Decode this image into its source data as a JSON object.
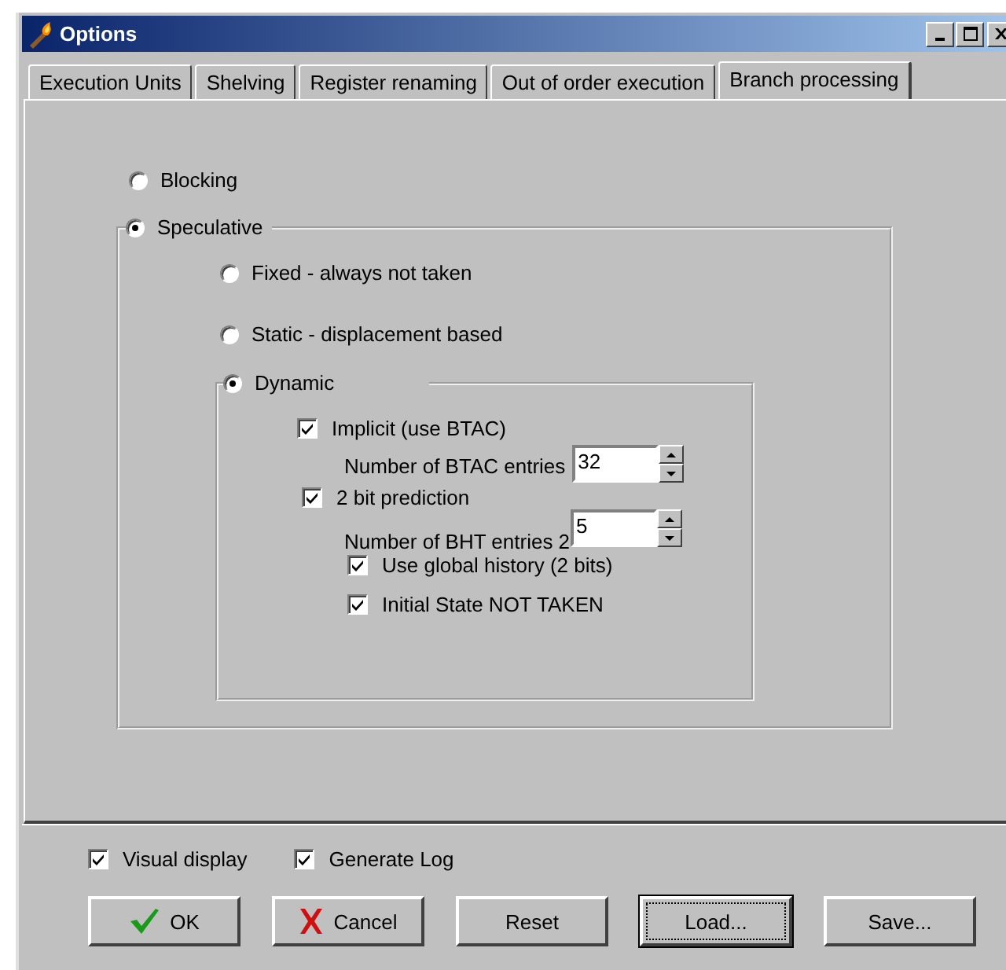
{
  "window": {
    "title": "Options"
  },
  "tabs": [
    {
      "label": "Execution Units",
      "selected": false
    },
    {
      "label": "Shelving",
      "selected": false
    },
    {
      "label": "Register renaming",
      "selected": false
    },
    {
      "label": "Out of order execution",
      "selected": false
    },
    {
      "label": "Branch processing",
      "selected": true
    }
  ],
  "branch_mode": [
    {
      "label": "Blocking",
      "selected": false
    },
    {
      "label": "Speculative",
      "selected": true
    }
  ],
  "prediction": [
    {
      "label": "Fixed - always not taken",
      "selected": false
    },
    {
      "label": "Static - displacement based",
      "selected": false
    },
    {
      "label": "Dynamic",
      "selected": true
    }
  ],
  "dynamic": {
    "implicit": {
      "label": "Implicit (use BTAC)",
      "checked": true
    },
    "btac_entries": {
      "label": "Number of BTAC entries",
      "value": "32"
    },
    "two_bit": {
      "label": "2 bit prediction",
      "checked": true
    },
    "bht_entries": {
      "label": "Number of BHT entries 2",
      "value": "5"
    },
    "global_history": {
      "label": "Use global history (2 bits)",
      "checked": true
    },
    "initial_state": {
      "label": "Initial State NOT TAKEN",
      "checked": true
    }
  },
  "options": [
    {
      "label": "Visual display",
      "checked": true
    },
    {
      "label": "Generate Log",
      "checked": true
    }
  ],
  "buttons": [
    {
      "label": "OK",
      "kind": "ok",
      "focused": false
    },
    {
      "label": "Cancel",
      "kind": "cancel",
      "focused": false
    },
    {
      "label": "Reset",
      "kind": "plain",
      "focused": false
    },
    {
      "label": "Load...",
      "kind": "plain",
      "focused": true
    },
    {
      "label": "Save...",
      "kind": "plain",
      "focused": false
    }
  ]
}
